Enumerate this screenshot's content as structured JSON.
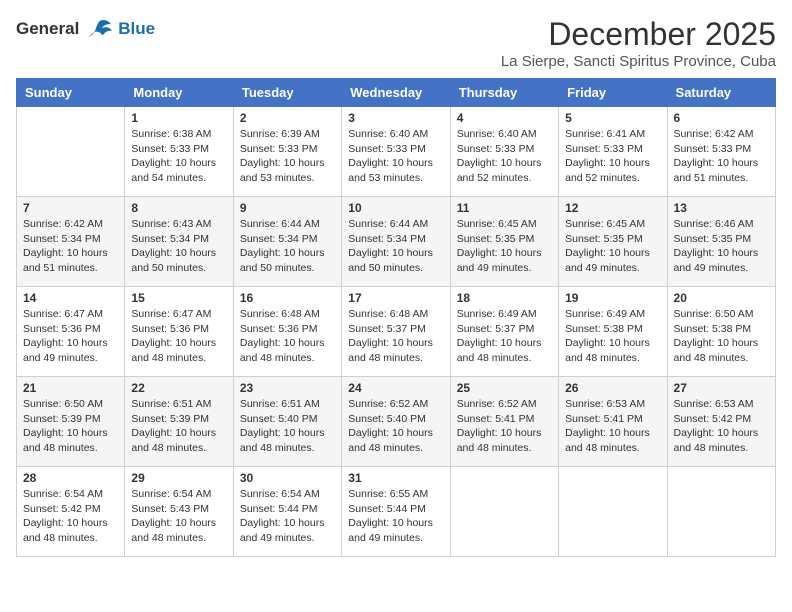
{
  "logo": {
    "general": "General",
    "blue": "Blue"
  },
  "title": {
    "month": "December 2025",
    "location": "La Sierpe, Sancti Spiritus Province, Cuba"
  },
  "headers": [
    "Sunday",
    "Monday",
    "Tuesday",
    "Wednesday",
    "Thursday",
    "Friday",
    "Saturday"
  ],
  "weeks": [
    [
      {
        "day": "",
        "sunrise": "",
        "sunset": "",
        "daylight": ""
      },
      {
        "day": "1",
        "sunrise": "Sunrise: 6:38 AM",
        "sunset": "Sunset: 5:33 PM",
        "daylight": "Daylight: 10 hours and 54 minutes."
      },
      {
        "day": "2",
        "sunrise": "Sunrise: 6:39 AM",
        "sunset": "Sunset: 5:33 PM",
        "daylight": "Daylight: 10 hours and 53 minutes."
      },
      {
        "day": "3",
        "sunrise": "Sunrise: 6:40 AM",
        "sunset": "Sunset: 5:33 PM",
        "daylight": "Daylight: 10 hours and 53 minutes."
      },
      {
        "day": "4",
        "sunrise": "Sunrise: 6:40 AM",
        "sunset": "Sunset: 5:33 PM",
        "daylight": "Daylight: 10 hours and 52 minutes."
      },
      {
        "day": "5",
        "sunrise": "Sunrise: 6:41 AM",
        "sunset": "Sunset: 5:33 PM",
        "daylight": "Daylight: 10 hours and 52 minutes."
      },
      {
        "day": "6",
        "sunrise": "Sunrise: 6:42 AM",
        "sunset": "Sunset: 5:33 PM",
        "daylight": "Daylight: 10 hours and 51 minutes."
      }
    ],
    [
      {
        "day": "7",
        "sunrise": "Sunrise: 6:42 AM",
        "sunset": "Sunset: 5:34 PM",
        "daylight": "Daylight: 10 hours and 51 minutes."
      },
      {
        "day": "8",
        "sunrise": "Sunrise: 6:43 AM",
        "sunset": "Sunset: 5:34 PM",
        "daylight": "Daylight: 10 hours and 50 minutes."
      },
      {
        "day": "9",
        "sunrise": "Sunrise: 6:44 AM",
        "sunset": "Sunset: 5:34 PM",
        "daylight": "Daylight: 10 hours and 50 minutes."
      },
      {
        "day": "10",
        "sunrise": "Sunrise: 6:44 AM",
        "sunset": "Sunset: 5:34 PM",
        "daylight": "Daylight: 10 hours and 50 minutes."
      },
      {
        "day": "11",
        "sunrise": "Sunrise: 6:45 AM",
        "sunset": "Sunset: 5:35 PM",
        "daylight": "Daylight: 10 hours and 49 minutes."
      },
      {
        "day": "12",
        "sunrise": "Sunrise: 6:45 AM",
        "sunset": "Sunset: 5:35 PM",
        "daylight": "Daylight: 10 hours and 49 minutes."
      },
      {
        "day": "13",
        "sunrise": "Sunrise: 6:46 AM",
        "sunset": "Sunset: 5:35 PM",
        "daylight": "Daylight: 10 hours and 49 minutes."
      }
    ],
    [
      {
        "day": "14",
        "sunrise": "Sunrise: 6:47 AM",
        "sunset": "Sunset: 5:36 PM",
        "daylight": "Daylight: 10 hours and 49 minutes."
      },
      {
        "day": "15",
        "sunrise": "Sunrise: 6:47 AM",
        "sunset": "Sunset: 5:36 PM",
        "daylight": "Daylight: 10 hours and 48 minutes."
      },
      {
        "day": "16",
        "sunrise": "Sunrise: 6:48 AM",
        "sunset": "Sunset: 5:36 PM",
        "daylight": "Daylight: 10 hours and 48 minutes."
      },
      {
        "day": "17",
        "sunrise": "Sunrise: 6:48 AM",
        "sunset": "Sunset: 5:37 PM",
        "daylight": "Daylight: 10 hours and 48 minutes."
      },
      {
        "day": "18",
        "sunrise": "Sunrise: 6:49 AM",
        "sunset": "Sunset: 5:37 PM",
        "daylight": "Daylight: 10 hours and 48 minutes."
      },
      {
        "day": "19",
        "sunrise": "Sunrise: 6:49 AM",
        "sunset": "Sunset: 5:38 PM",
        "daylight": "Daylight: 10 hours and 48 minutes."
      },
      {
        "day": "20",
        "sunrise": "Sunrise: 6:50 AM",
        "sunset": "Sunset: 5:38 PM",
        "daylight": "Daylight: 10 hours and 48 minutes."
      }
    ],
    [
      {
        "day": "21",
        "sunrise": "Sunrise: 6:50 AM",
        "sunset": "Sunset: 5:39 PM",
        "daylight": "Daylight: 10 hours and 48 minutes."
      },
      {
        "day": "22",
        "sunrise": "Sunrise: 6:51 AM",
        "sunset": "Sunset: 5:39 PM",
        "daylight": "Daylight: 10 hours and 48 minutes."
      },
      {
        "day": "23",
        "sunrise": "Sunrise: 6:51 AM",
        "sunset": "Sunset: 5:40 PM",
        "daylight": "Daylight: 10 hours and 48 minutes."
      },
      {
        "day": "24",
        "sunrise": "Sunrise: 6:52 AM",
        "sunset": "Sunset: 5:40 PM",
        "daylight": "Daylight: 10 hours and 48 minutes."
      },
      {
        "day": "25",
        "sunrise": "Sunrise: 6:52 AM",
        "sunset": "Sunset: 5:41 PM",
        "daylight": "Daylight: 10 hours and 48 minutes."
      },
      {
        "day": "26",
        "sunrise": "Sunrise: 6:53 AM",
        "sunset": "Sunset: 5:41 PM",
        "daylight": "Daylight: 10 hours and 48 minutes."
      },
      {
        "day": "27",
        "sunrise": "Sunrise: 6:53 AM",
        "sunset": "Sunset: 5:42 PM",
        "daylight": "Daylight: 10 hours and 48 minutes."
      }
    ],
    [
      {
        "day": "28",
        "sunrise": "Sunrise: 6:54 AM",
        "sunset": "Sunset: 5:42 PM",
        "daylight": "Daylight: 10 hours and 48 minutes."
      },
      {
        "day": "29",
        "sunrise": "Sunrise: 6:54 AM",
        "sunset": "Sunset: 5:43 PM",
        "daylight": "Daylight: 10 hours and 48 minutes."
      },
      {
        "day": "30",
        "sunrise": "Sunrise: 6:54 AM",
        "sunset": "Sunset: 5:44 PM",
        "daylight": "Daylight: 10 hours and 49 minutes."
      },
      {
        "day": "31",
        "sunrise": "Sunrise: 6:55 AM",
        "sunset": "Sunset: 5:44 PM",
        "daylight": "Daylight: 10 hours and 49 minutes."
      },
      {
        "day": "",
        "sunrise": "",
        "sunset": "",
        "daylight": ""
      },
      {
        "day": "",
        "sunrise": "",
        "sunset": "",
        "daylight": ""
      },
      {
        "day": "",
        "sunrise": "",
        "sunset": "",
        "daylight": ""
      }
    ]
  ]
}
